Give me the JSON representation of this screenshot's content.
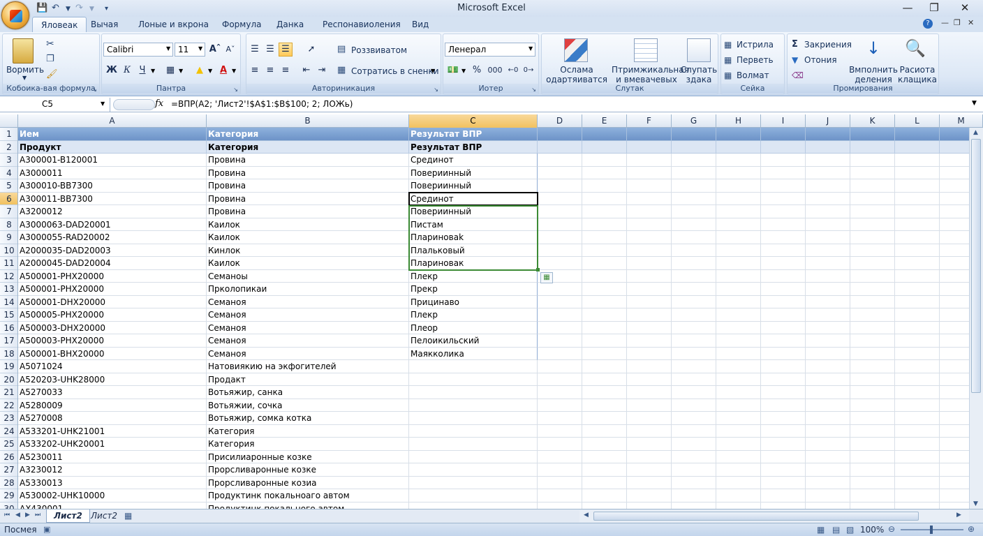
{
  "window": {
    "title": "Microsoft Excel"
  },
  "tabs": [
    {
      "label": "Яловеак",
      "active": true
    },
    {
      "label": "Вычая"
    },
    {
      "label": "Лоные и вкрона"
    },
    {
      "label": "Формула"
    },
    {
      "label": "Данка"
    },
    {
      "label": "Респонавиоления"
    },
    {
      "label": "Вид"
    }
  ],
  "ribbon": {
    "clipboard": {
      "paste": "Вормить",
      "label": "Кобоика-вая формула"
    },
    "font": {
      "name": "Calibri",
      "size": "11",
      "bold": "Ж",
      "italic": "К",
      "underline": "Ч",
      "label": "Пантра"
    },
    "align": {
      "wrap": "Роззвиватом",
      "merge": "Сотратись в сненки",
      "label": "Авториникация"
    },
    "number": {
      "format": "Ленерал",
      "percent": "%",
      "thousands": "000",
      "label": "Иотер"
    },
    "styles": {
      "b1": "Ослама",
      "b1b": "одартяиватся",
      "b2": "Птримжикальная",
      "b2b": "и вмевачевых",
      "b3": "Слупать",
      "b3b": "здака",
      "label": "Слутак"
    },
    "cells": {
      "insert": "Истрила",
      "delete": "Перветь",
      "format": "Волмат",
      "label": "Сейка"
    },
    "edit": {
      "sum": "Закриения",
      "fill": "Отония",
      "sort1": "Вмполнить",
      "sort1b": "деления",
      "find1": "Расиота",
      "find1b": "клащика",
      "label": "Промирования"
    }
  },
  "namebox": "C5",
  "formula": "=ВПР(A2; 'Лист2'!$A$1:$B$100; 2; ЛОЖь)",
  "columns": [
    "A",
    "B",
    "C",
    "D",
    "E",
    "F",
    "G",
    "H",
    "I",
    "J",
    "K",
    "L",
    "M"
  ],
  "rows": [
    {
      "n": "1",
      "a": "Ием",
      "b": "Категория",
      "c": "Результат ВПР"
    },
    {
      "n": "2",
      "a": "Продукт",
      "b": "Категория",
      "c": "Результат ВПР"
    },
    {
      "n": "3",
      "a": "A300001-B120001",
      "b": "Провина",
      "c": "Срединот"
    },
    {
      "n": "4",
      "a": "A3000011",
      "b": "Провина",
      "c": "Повериинный"
    },
    {
      "n": "5",
      "a": "A300010-BB7300",
      "b": "Провина",
      "c": "Повериинный"
    },
    {
      "n": "6",
      "a": "A300011-BB7300",
      "b": "Провина",
      "c": "Срединот"
    },
    {
      "n": "7",
      "a": "A3200012",
      "b": "Провина",
      "c": "Повериинный"
    },
    {
      "n": "8",
      "a": "A3000063-DAD20001",
      "b": "Каилок",
      "c": "Пистам"
    },
    {
      "n": "9",
      "a": "A3000055-RAD20002",
      "b": "Каилок",
      "c": "Плариноваk"
    },
    {
      "n": "10",
      "a": "A2000035-DAD20003",
      "b": "Кинлок",
      "c": "Плальковый"
    },
    {
      "n": "11",
      "a": "A2000045-DAD20004",
      "b": "Каилок",
      "c": "Плариновак"
    },
    {
      "n": "12",
      "a": "A500001-PHX20000",
      "b": "Семаноы",
      "c": "Плекр"
    },
    {
      "n": "13",
      "a": "A500001-PHX20000",
      "b": "Прколопикаи",
      "c": "Прекр"
    },
    {
      "n": "14",
      "a": "A500001-DHX20000",
      "b": "Семаноя",
      "c": "Прицинаво"
    },
    {
      "n": "15",
      "a": "A500005-PHX20000",
      "b": "Семаноя",
      "c": "Плекр"
    },
    {
      "n": "16",
      "a": "A500003-DHX20000",
      "b": "Семаноя",
      "c": "Плеор"
    },
    {
      "n": "17",
      "a": "A500003-PHX20000",
      "b": "Семаноя",
      "c": "Пелоикильский"
    },
    {
      "n": "18",
      "a": "A500001-BHX20000",
      "b": "Семаноя",
      "c": "Маякколика"
    },
    {
      "n": "19",
      "a": "A5071024",
      "b": "Натовиякию на экфогителей",
      "c": ""
    },
    {
      "n": "20",
      "a": "A520203-UHK28000",
      "b": "Продакт",
      "c": ""
    },
    {
      "n": "21",
      "a": "A5270033",
      "b": "Вотьяжир, санка",
      "c": ""
    },
    {
      "n": "22",
      "a": "A5280009",
      "b": "Вотьяжии, сочка",
      "c": ""
    },
    {
      "n": "23",
      "a": "A5270008",
      "b": "Вотьяжир, сомка котка",
      "c": ""
    },
    {
      "n": "24",
      "a": "A533201-UHK21001",
      "b": "Категория",
      "c": ""
    },
    {
      "n": "25",
      "a": "A533202-UHK20001",
      "b": "Категория",
      "c": ""
    },
    {
      "n": "26",
      "a": "A5230011",
      "b": "Присилиаронные козке",
      "c": ""
    },
    {
      "n": "27",
      "a": "A3230012",
      "b": "Прорсливаронные козке",
      "c": ""
    },
    {
      "n": "28",
      "a": "A5330013",
      "b": "Прорсливаронные козиа",
      "c": ""
    },
    {
      "n": "29",
      "a": "A530002-UHK10000",
      "b": "Продуктинк покальноаго автом",
      "c": ""
    },
    {
      "n": "30",
      "a": "AX430001",
      "b": "Продуктинк покального автом",
      "c": ""
    }
  ],
  "sheets": [
    {
      "label": "Лист2",
      "active": true
    },
    {
      "label": "Лист2"
    }
  ],
  "status": {
    "mode": "Посмея",
    "zoom": "100%"
  }
}
